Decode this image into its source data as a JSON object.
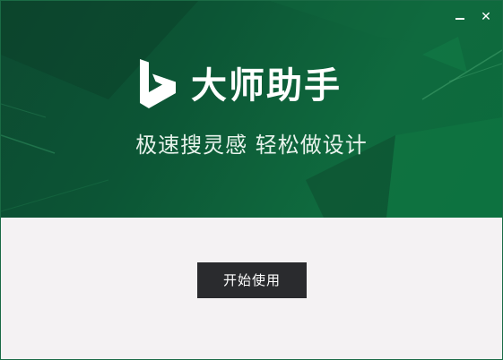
{
  "window": {
    "minimize_icon": "minimize-icon",
    "close_icon": "close-icon",
    "close_glyph": "✕"
  },
  "banner": {
    "logo_icon": "bing-logo-icon",
    "app_title": "大师助手",
    "slogan": "极速搜灵感 轻松做设计"
  },
  "actions": {
    "start_label": "开始使用"
  },
  "colors": {
    "banner_dark": "#0d4a31",
    "banner_light": "#0f6a3e",
    "button_bg": "#2a2b2e",
    "body_bg": "#f4f2f3"
  }
}
